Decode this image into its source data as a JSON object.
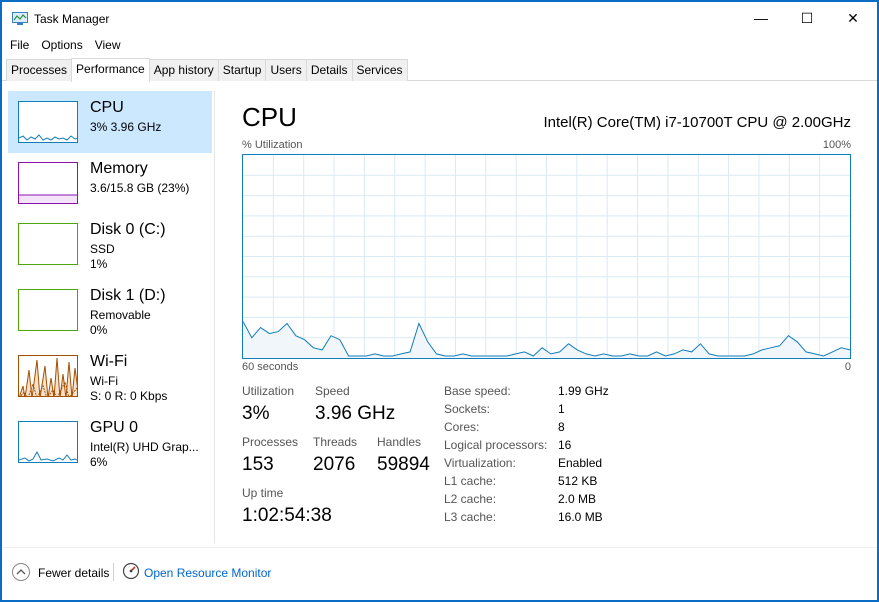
{
  "window": {
    "title": "Task Manager",
    "controls": {
      "minimize": "—",
      "maximize": "☐",
      "close": "✕"
    }
  },
  "menu": [
    "File",
    "Options",
    "View"
  ],
  "tabs": [
    "Processes",
    "Performance",
    "App history",
    "Startup",
    "Users",
    "Details",
    "Services"
  ],
  "active_tab": "Performance",
  "sidebar": {
    "items": [
      {
        "name": "CPU",
        "lines": [
          "3% 3.96 GHz"
        ],
        "color": "#117dbb",
        "selected": true
      },
      {
        "name": "Memory",
        "lines": [
          "3.6/15.8 GB (23%)"
        ],
        "color": "#8b12ae"
      },
      {
        "name": "Disk 0 (C:)",
        "lines": [
          "SSD",
          "1%"
        ],
        "color": "#4da60c"
      },
      {
        "name": "Disk 1 (D:)",
        "lines": [
          "Removable",
          "0%"
        ],
        "color": "#4da60c"
      },
      {
        "name": "Wi-Fi",
        "lines": [
          "Wi-Fi",
          "S: 0 R: 0 Kbps"
        ],
        "color": "#a74f01"
      },
      {
        "name": "GPU 0",
        "lines": [
          "Intel(R) UHD Grap...",
          "6%"
        ],
        "color": "#117dbb"
      }
    ]
  },
  "main": {
    "title": "CPU",
    "model": "Intel(R) Core(TM) i7-10700T CPU @ 2.00GHz",
    "graph": {
      "y_label": "% Utilization",
      "y_max": "100%",
      "x_left": "60 seconds",
      "x_right": "0",
      "line_color": "#117dbb",
      "fill_color": "#f1f6fa",
      "grid_color": "#d9eaf4",
      "utilization_percent": [
        18,
        10,
        15,
        12,
        13,
        17,
        11,
        9,
        5,
        4,
        11,
        9,
        1,
        1,
        1,
        2,
        1,
        1,
        2,
        3,
        17,
        8,
        2,
        1,
        1,
        2,
        1,
        1,
        1,
        1,
        1,
        2,
        3,
        1,
        5,
        2,
        3,
        7,
        4,
        2,
        1,
        2,
        1,
        1,
        2,
        1,
        1,
        3,
        1,
        2,
        4,
        3,
        7,
        2,
        1,
        1,
        1,
        1,
        2,
        4,
        5,
        6,
        11,
        8,
        3,
        2,
        1,
        3,
        5,
        4
      ]
    },
    "stats": {
      "utilization": {
        "label": "Utilization",
        "value": "3%"
      },
      "speed": {
        "label": "Speed",
        "value": "3.96 GHz"
      },
      "processes": {
        "label": "Processes",
        "value": "153"
      },
      "threads": {
        "label": "Threads",
        "value": "2076"
      },
      "handles": {
        "label": "Handles",
        "value": "59894"
      },
      "uptime": {
        "label": "Up time",
        "value": "1:02:54:38"
      }
    },
    "specs": [
      {
        "label": "Base speed:",
        "value": "1.99 GHz"
      },
      {
        "label": "Sockets:",
        "value": "1"
      },
      {
        "label": "Cores:",
        "value": "8"
      },
      {
        "label": "Logical processors:",
        "value": "16"
      },
      {
        "label": "Virtualization:",
        "value": "Enabled"
      },
      {
        "label": "L1 cache:",
        "value": "512 KB"
      },
      {
        "label": "L2 cache:",
        "value": "2.0 MB"
      },
      {
        "label": "L3 cache:",
        "value": "16.0 MB"
      }
    ]
  },
  "footer": {
    "fewer_details": "Fewer details",
    "open_resource_monitor": "Open Resource Monitor"
  }
}
